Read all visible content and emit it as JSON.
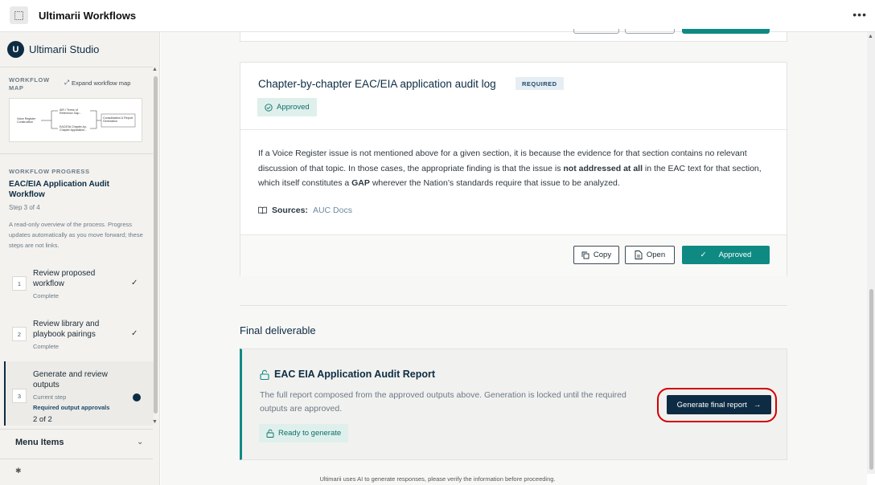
{
  "app": {
    "title": "Ultimarii Workflows"
  },
  "sidebar": {
    "brand": "Ultimarii Studio",
    "brand_mark": "U",
    "workflow_map": {
      "label": "WORKFLOW MAP",
      "expand_label": "Expand workflow map",
      "nodes": [
        "Voice Register Construction",
        "AIR / Terms of Reference Gap...",
        "EAC/EIA Chapter-by-Chapter Application...",
        "Consolidation & Report Generation"
      ]
    },
    "progress": {
      "label": "WORKFLOW PROGRESS",
      "title": "EAC/EIA Application Audit Workflow",
      "step_of": "Step 3 of 4",
      "description": "A read-only overview of the process. Progress updates automatically as you move forward; these steps are not links."
    },
    "steps": [
      {
        "num": "1",
        "title": "Review proposed workflow",
        "status": "Complete"
      },
      {
        "num": "2",
        "title": "Review library and playbook pairings",
        "status": "Complete"
      },
      {
        "num": "3",
        "title": "Generate and review outputs",
        "status": "Current step",
        "requirement": "Required output approvals",
        "count": "2 of 2"
      }
    ],
    "menu_items": "Menu Items"
  },
  "card": {
    "title": "Chapter-by-chapter EAC/EIA application audit log",
    "required": "REQUIRED",
    "status": "Approved",
    "body_1": "If a Voice Register issue is not mentioned above for a given section, it is because the evidence for that section contains no relevant discussion of that topic. In those cases, the appropriate finding is that the issue is ",
    "body_bold_1": "not addressed at all",
    "body_2": " in the EAC text for that section, which itself constitutes a ",
    "body_bold_2": "GAP",
    "body_3": " wherever the Nation’s standards require that issue to be analyzed.",
    "sources_label": "Sources:",
    "sources_link": "AUC Docs",
    "buttons": {
      "copy": "Copy",
      "open": "Open",
      "approved": "Approved"
    }
  },
  "final": {
    "heading": "Final deliverable",
    "title": "EAC EIA Application Audit Report",
    "description": "The full report composed from the approved outputs above. Generation is locked until the required outputs are approved.",
    "status": "Ready to generate",
    "generate_label": "Generate final report"
  },
  "disclaimer": "Ultimarii uses AI to generate responses, please verify the information before proceeding.",
  "colors": {
    "navy": "#0d2c43",
    "teal": "#0e8a83",
    "highlight": "#d40000"
  }
}
